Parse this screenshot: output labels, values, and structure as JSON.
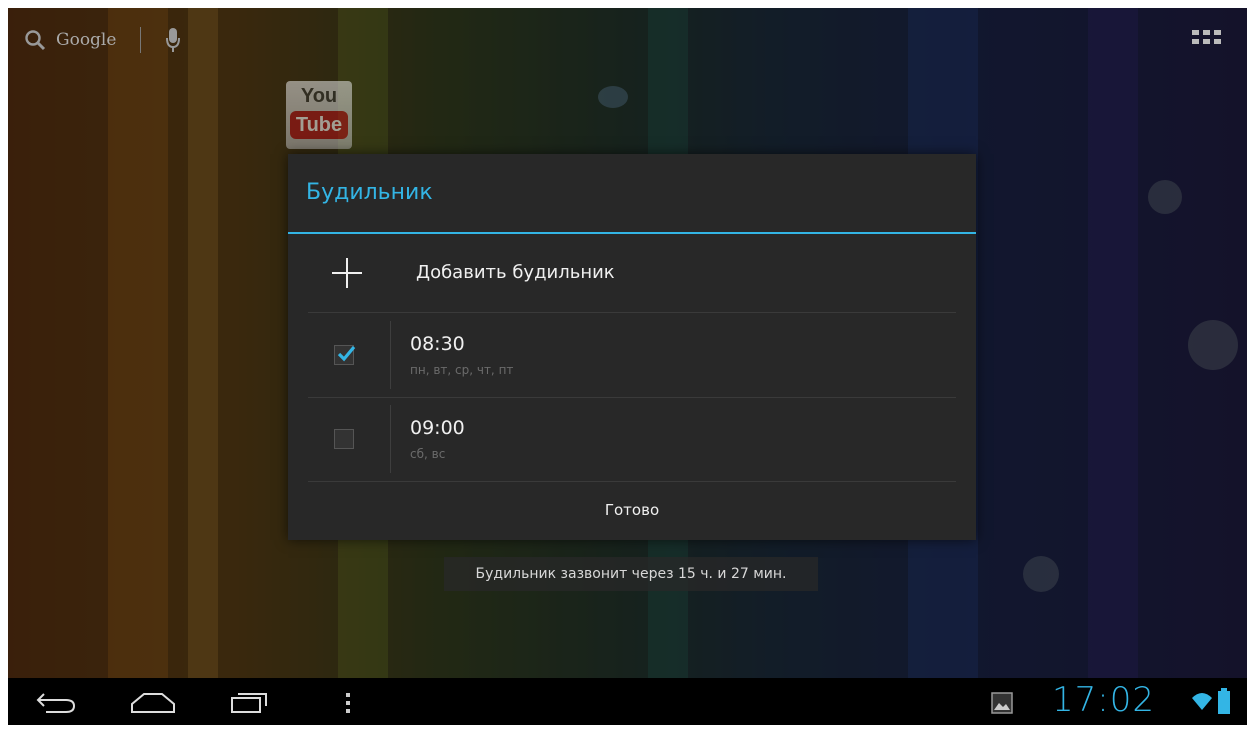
{
  "search": {
    "text": "Google"
  },
  "youtube_icon": {
    "line1": "You",
    "line2": "Tube"
  },
  "dialog": {
    "title": "Будильник",
    "add_label": "Добавить будильник",
    "alarms": [
      {
        "time": "08:30",
        "days": "пн, вт, ср, чт, пт",
        "enabled": true
      },
      {
        "time": "09:00",
        "days": "сб, вс",
        "enabled": false
      }
    ],
    "done_label": "Готово"
  },
  "toast": "Будильник зазвонит через 15 ч. и 27 мин.",
  "statusbar": {
    "time": "17:02"
  },
  "colors": {
    "accent": "#33b5e5",
    "dialog_bg": "#282828",
    "navbar_bg": "#000000"
  },
  "icons": [
    "search-icon",
    "mic-icon",
    "apps-grid-icon",
    "youtube-icon",
    "plus-icon",
    "checkbox-checked-icon",
    "checkbox-empty-icon",
    "back-icon",
    "home-icon",
    "recents-icon",
    "menu-dots-icon",
    "gallery-icon",
    "wifi-icon",
    "battery-icon"
  ]
}
